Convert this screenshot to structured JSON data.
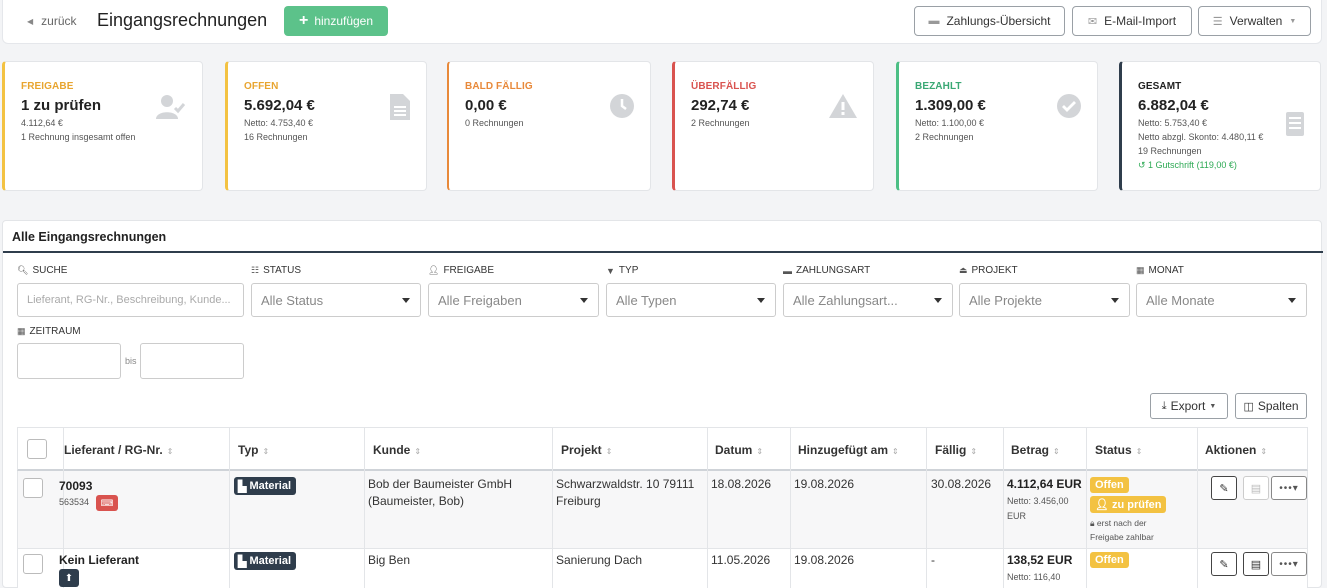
{
  "header": {
    "back_label": "zurück",
    "title": "Eingangsrechnungen",
    "add_label": "hinzufügen",
    "btn_payments": "Zahlungs-Übersicht",
    "btn_email_import": "E-Mail-Import",
    "btn_manage": "Verwalten"
  },
  "cards": [
    {
      "label": "FREIGABE",
      "value": "1 zu prüfen",
      "sub1": "4.112,64 €",
      "sub2": "1 Rechnung insgesamt offen",
      "color": "#f3c242",
      "icon": "user-check-icon"
    },
    {
      "label": "OFFEN",
      "value": "5.692,04 €",
      "sub1": "Netto: 4.753,40 €",
      "sub2": "16 Rechnungen",
      "color": "#f3c242",
      "icon": "document-icon"
    },
    {
      "label": "BALD FÄLLIG",
      "value": "0,00 €",
      "sub1": "0 Rechnungen",
      "color": "#e8893a",
      "icon": "clock-icon"
    },
    {
      "label": "ÜBERFÄLLIG",
      "value": "292,74 €",
      "sub1": "2 Rechnungen",
      "color": "#d9534f",
      "icon": "warning-icon"
    },
    {
      "label": "BEZAHLT",
      "value": "1.309,00 €",
      "sub1": "Netto: 1.100,00 €",
      "sub2": "2 Rechnungen",
      "color": "#4cbf85",
      "icon": "check-circle-icon"
    },
    {
      "label": "GESAMT",
      "value": "6.882,04 €",
      "sub1": "Netto: 5.753,40 €",
      "sub2": "Netto abzgl. Skonto: 4.480,11 €",
      "sub3": "19 Rechnungen",
      "sub4": "1 Gutschrift (119,00 €)",
      "color": "#2f3d4c",
      "icon": "receipt-icon"
    }
  ],
  "panel": {
    "title": "Alle Eingangsrechnungen",
    "filters": {
      "search_label": "SUCHE",
      "search_placeholder": "Lieferant, RG-Nr., Beschreibung, Kunde...",
      "status_label": "STATUS",
      "status_value": "Alle Status",
      "approval_label": "FREIGABE",
      "approval_value": "Alle Freigaben",
      "type_label": "TYP",
      "type_value": "Alle Typen",
      "payment_label": "ZAHLUNGSART",
      "payment_value": "Alle Zahlungsart...",
      "project_label": "PROJEKT",
      "project_value": "Alle Projekte",
      "month_label": "MONAT",
      "month_value": "Alle Monate",
      "range_label": "ZEITRAUM",
      "range_sep": "bis"
    },
    "export_label": "Export",
    "columns_label": "Spalten"
  },
  "table": {
    "headers": [
      "Lieferant / RG-Nr.",
      "Typ",
      "Kunde",
      "Projekt",
      "Datum",
      "Hinzugefügt am",
      "Fällig",
      "Betrag",
      "Status",
      "Aktionen"
    ],
    "rows": [
      {
        "supplier": "70093",
        "invoice_no": "563534",
        "type": "Material",
        "customer_line1": "Bob der Baumeister GmbH",
        "customer_line2": "(Baumeister, Bob)",
        "project_line1": "Schwarzwaldstr. 10 79111",
        "project_line2": "Freiburg",
        "date": "18.08.2026",
        "added": "19.08.2026",
        "due": "30.08.2026",
        "amount": "4.112,64 EUR",
        "net_line1": "Netto: 3.456,00",
        "net_line2": "EUR",
        "status": "Offen",
        "approval": "zu prüfen",
        "approval_note1": "erst nach der",
        "approval_note2": "Freigabe zahlbar"
      },
      {
        "supplier": "Kein Lieferant",
        "type": "Material",
        "customer_line1": "Big Ben",
        "project_line1": "Sanierung Dach",
        "date": "11.05.2026",
        "added": "19.08.2026",
        "due": "-",
        "amount": "138,52 EUR",
        "net_line1": "Netto: 116,40",
        "status": "Offen"
      }
    ]
  }
}
